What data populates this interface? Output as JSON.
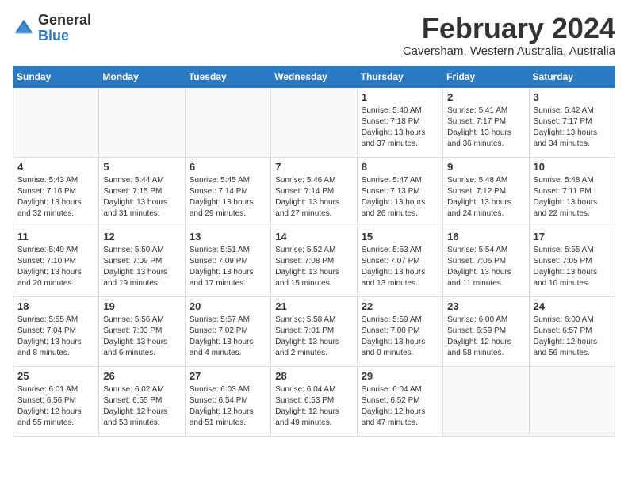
{
  "header": {
    "logo_general": "General",
    "logo_blue": "Blue",
    "month_title": "February 2024",
    "location": "Caversham, Western Australia, Australia"
  },
  "weekdays": [
    "Sunday",
    "Monday",
    "Tuesday",
    "Wednesday",
    "Thursday",
    "Friday",
    "Saturday"
  ],
  "weeks": [
    [
      {
        "day": "",
        "empty": true
      },
      {
        "day": "",
        "empty": true
      },
      {
        "day": "",
        "empty": true
      },
      {
        "day": "",
        "empty": true
      },
      {
        "day": "1",
        "sunrise": "5:40 AM",
        "sunset": "7:18 PM",
        "daylight": "13 hours and 37 minutes."
      },
      {
        "day": "2",
        "sunrise": "5:41 AM",
        "sunset": "7:17 PM",
        "daylight": "13 hours and 36 minutes."
      },
      {
        "day": "3",
        "sunrise": "5:42 AM",
        "sunset": "7:17 PM",
        "daylight": "13 hours and 34 minutes."
      }
    ],
    [
      {
        "day": "4",
        "sunrise": "5:43 AM",
        "sunset": "7:16 PM",
        "daylight": "13 hours and 32 minutes."
      },
      {
        "day": "5",
        "sunrise": "5:44 AM",
        "sunset": "7:15 PM",
        "daylight": "13 hours and 31 minutes."
      },
      {
        "day": "6",
        "sunrise": "5:45 AM",
        "sunset": "7:14 PM",
        "daylight": "13 hours and 29 minutes."
      },
      {
        "day": "7",
        "sunrise": "5:46 AM",
        "sunset": "7:14 PM",
        "daylight": "13 hours and 27 minutes."
      },
      {
        "day": "8",
        "sunrise": "5:47 AM",
        "sunset": "7:13 PM",
        "daylight": "13 hours and 26 minutes."
      },
      {
        "day": "9",
        "sunrise": "5:48 AM",
        "sunset": "7:12 PM",
        "daylight": "13 hours and 24 minutes."
      },
      {
        "day": "10",
        "sunrise": "5:48 AM",
        "sunset": "7:11 PM",
        "daylight": "13 hours and 22 minutes."
      }
    ],
    [
      {
        "day": "11",
        "sunrise": "5:49 AM",
        "sunset": "7:10 PM",
        "daylight": "13 hours and 20 minutes."
      },
      {
        "day": "12",
        "sunrise": "5:50 AM",
        "sunset": "7:09 PM",
        "daylight": "13 hours and 19 minutes."
      },
      {
        "day": "13",
        "sunrise": "5:51 AM",
        "sunset": "7:09 PM",
        "daylight": "13 hours and 17 minutes."
      },
      {
        "day": "14",
        "sunrise": "5:52 AM",
        "sunset": "7:08 PM",
        "daylight": "13 hours and 15 minutes."
      },
      {
        "day": "15",
        "sunrise": "5:53 AM",
        "sunset": "7:07 PM",
        "daylight": "13 hours and 13 minutes."
      },
      {
        "day": "16",
        "sunrise": "5:54 AM",
        "sunset": "7:06 PM",
        "daylight": "13 hours and 11 minutes."
      },
      {
        "day": "17",
        "sunrise": "5:55 AM",
        "sunset": "7:05 PM",
        "daylight": "13 hours and 10 minutes."
      }
    ],
    [
      {
        "day": "18",
        "sunrise": "5:55 AM",
        "sunset": "7:04 PM",
        "daylight": "13 hours and 8 minutes."
      },
      {
        "day": "19",
        "sunrise": "5:56 AM",
        "sunset": "7:03 PM",
        "daylight": "13 hours and 6 minutes."
      },
      {
        "day": "20",
        "sunrise": "5:57 AM",
        "sunset": "7:02 PM",
        "daylight": "13 hours and 4 minutes."
      },
      {
        "day": "21",
        "sunrise": "5:58 AM",
        "sunset": "7:01 PM",
        "daylight": "13 hours and 2 minutes."
      },
      {
        "day": "22",
        "sunrise": "5:59 AM",
        "sunset": "7:00 PM",
        "daylight": "13 hours and 0 minutes."
      },
      {
        "day": "23",
        "sunrise": "6:00 AM",
        "sunset": "6:59 PM",
        "daylight": "12 hours and 58 minutes."
      },
      {
        "day": "24",
        "sunrise": "6:00 AM",
        "sunset": "6:57 PM",
        "daylight": "12 hours and 56 minutes."
      }
    ],
    [
      {
        "day": "25",
        "sunrise": "6:01 AM",
        "sunset": "6:56 PM",
        "daylight": "12 hours and 55 minutes."
      },
      {
        "day": "26",
        "sunrise": "6:02 AM",
        "sunset": "6:55 PM",
        "daylight": "12 hours and 53 minutes."
      },
      {
        "day": "27",
        "sunrise": "6:03 AM",
        "sunset": "6:54 PM",
        "daylight": "12 hours and 51 minutes."
      },
      {
        "day": "28",
        "sunrise": "6:04 AM",
        "sunset": "6:53 PM",
        "daylight": "12 hours and 49 minutes."
      },
      {
        "day": "29",
        "sunrise": "6:04 AM",
        "sunset": "6:52 PM",
        "daylight": "12 hours and 47 minutes."
      },
      {
        "day": "",
        "empty": true
      },
      {
        "day": "",
        "empty": true
      }
    ]
  ]
}
